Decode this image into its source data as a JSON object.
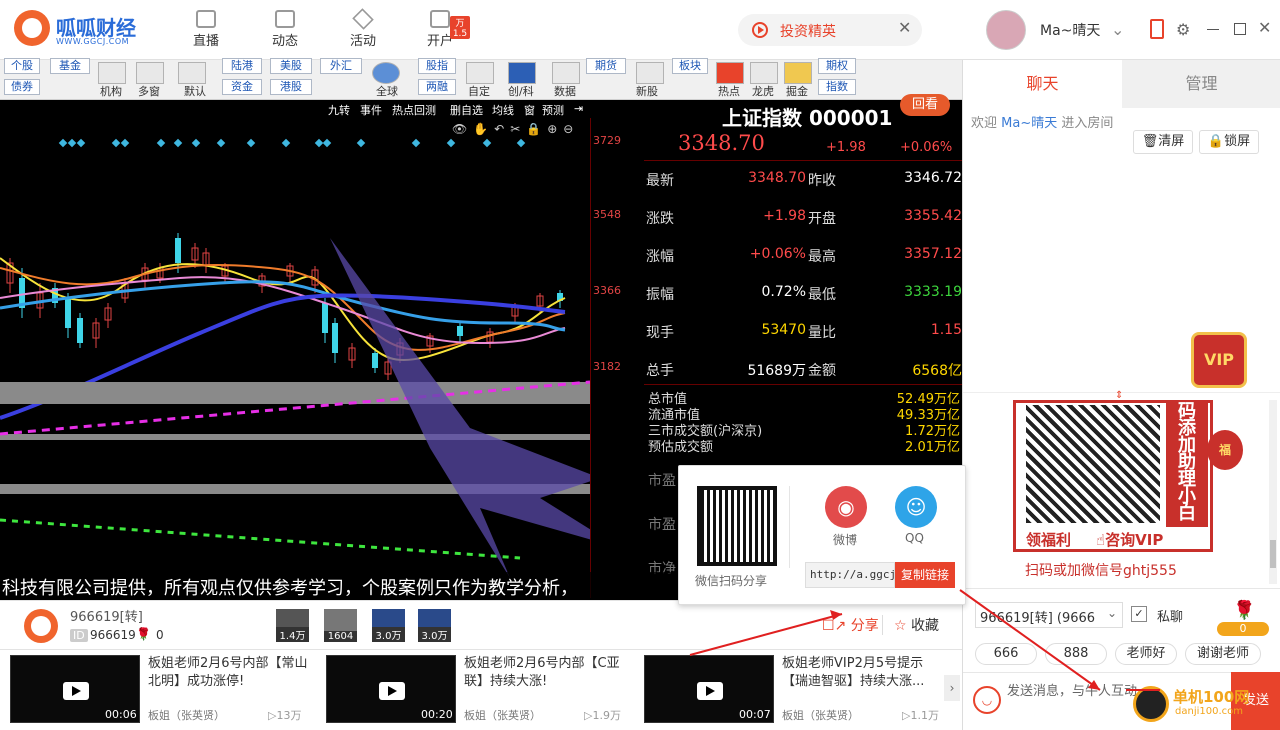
{
  "header": {
    "brand": "呱呱财经",
    "url": "WWW.GGCJ.COM",
    "nav": [
      {
        "label": "直播",
        "icon": "video-icon"
      },
      {
        "label": "动态",
        "icon": "feed-icon"
      },
      {
        "label": "活动",
        "icon": "layers-icon"
      },
      {
        "label": "开户",
        "icon": "account-icon",
        "badge": "万1.5"
      }
    ],
    "promo_label": "投资精英",
    "username": "Ma~晴天"
  },
  "toolbar": {
    "small_buttons": [
      [
        "个股",
        "债券"
      ],
      [
        "基金"
      ],
      [
        "陆港",
        "资金"
      ],
      [
        "美股",
        "港股"
      ],
      [
        "外汇"
      ],
      [
        "股指",
        "两融"
      ],
      [
        "期货"
      ],
      [
        "板块"
      ],
      [
        "期权",
        "指数"
      ]
    ],
    "icon_buttons": [
      "机构",
      "多窗",
      "默认",
      "全球",
      "自定",
      "创/科",
      "数据",
      "新股",
      "热点",
      "龙虎",
      "掘金"
    ]
  },
  "chart": {
    "top_tools": [
      "九转",
      "事件",
      "热点回测",
      "删自选",
      "均线",
      "窗",
      "预测"
    ],
    "y_ticks": [
      "3729",
      "3548",
      "3366",
      "3182"
    ],
    "caption": "科技有限公司提供，所有观点仅供参考学习，个股案例只作为教学分析，"
  },
  "quote": {
    "title": "上证指数 000001",
    "replay": "回看",
    "price": "3348.70",
    "change": "+1.98",
    "pct": "+0.06%",
    "rows": [
      {
        "k1": "最新",
        "v1": "3348.70",
        "c1": "#ff4b4b",
        "k2": "昨收",
        "v2": "3346.72",
        "c2": "#ffffff"
      },
      {
        "k1": "涨跌",
        "v1": "+1.98",
        "c1": "#ff4b4b",
        "k2": "开盘",
        "v2": "3355.42",
        "c2": "#ff4b4b"
      },
      {
        "k1": "涨幅",
        "v1": "+0.06%",
        "c1": "#ff4b4b",
        "k2": "最高",
        "v2": "3357.12",
        "c2": "#ff4b4b"
      },
      {
        "k1": "振幅",
        "v1": "0.72%",
        "c1": "#ffffff",
        "k2": "最低",
        "v2": "3333.19",
        "c2": "#3dd63d"
      },
      {
        "k1": "现手",
        "v1": "53470",
        "c1": "#ffd700",
        "k2": "量比",
        "v2": "1.15",
        "c2": "#ff4b4b"
      },
      {
        "k1": "总手",
        "v1": "51689万",
        "c1": "#ffffff",
        "k2": "金额",
        "v2": "6568亿",
        "c2": "#ffd700"
      }
    ],
    "lower": [
      {
        "k": "总市值",
        "v": "52.49万亿"
      },
      {
        "k": "流通市值",
        "v": "49.33万亿"
      },
      {
        "k": "三市成交额(沪深京)",
        "v": "1.72万亿"
      },
      {
        "k": "预估成交额",
        "v": "2.01万亿"
      }
    ],
    "faded": [
      "市盈",
      "市盈",
      "市净"
    ]
  },
  "room": {
    "name": "966619[转]",
    "id": "966619",
    "flowers": "0",
    "guests": [
      "1.4万",
      "1604",
      "3.0万",
      "3.0万"
    ],
    "share": "分享",
    "collect": "收藏"
  },
  "videos": [
    {
      "title": "板姐老师2月6号内部【常山北明】成功涨停!",
      "duration": "00:06",
      "author": "板姐（张英贤）",
      "views": "13万"
    },
    {
      "title": "板姐老师2月6号内部【C亚联】持续大涨!",
      "duration": "00:20",
      "author": "板姐（张英贤）",
      "views": "1.9万"
    },
    {
      "title": "板姐老师VIP2月5号提示【瑞迪智驱】持续大涨...",
      "duration": "00:07",
      "author": "板姐（张英贤）",
      "views": "1.1万"
    }
  ],
  "share_popup": {
    "wechat_label": "微信扫码分享",
    "weibo": "微博",
    "qq": "QQ",
    "link": "http://a.ggcj.",
    "copy": "复制链接"
  },
  "sidebar": {
    "tabs": [
      "聊天",
      "管理"
    ],
    "welcome_prefix": "欢迎",
    "welcome_user": "Ma~晴天",
    "welcome_suffix": "进入房间",
    "clear": "清屏",
    "lock": "锁屏",
    "vip": "VIP",
    "ad_side": [
      "码",
      "添",
      "加",
      "助",
      "理",
      "小",
      "白"
    ],
    "ad_buttons": [
      "领福利",
      "咨询VIP"
    ],
    "ad_caption": "扫码或加微信号ghtj555",
    "fu": "福",
    "room_select": "966619[转] (9666",
    "private": "私聊",
    "gift_count": "0",
    "quick": [
      "666",
      "888",
      "老师好",
      "谢谢老师"
    ],
    "input_placeholder": "发送消息，与牛人互动",
    "send": "发送",
    "watermark": "单机100网",
    "watermark_url": "danji100.com"
  }
}
